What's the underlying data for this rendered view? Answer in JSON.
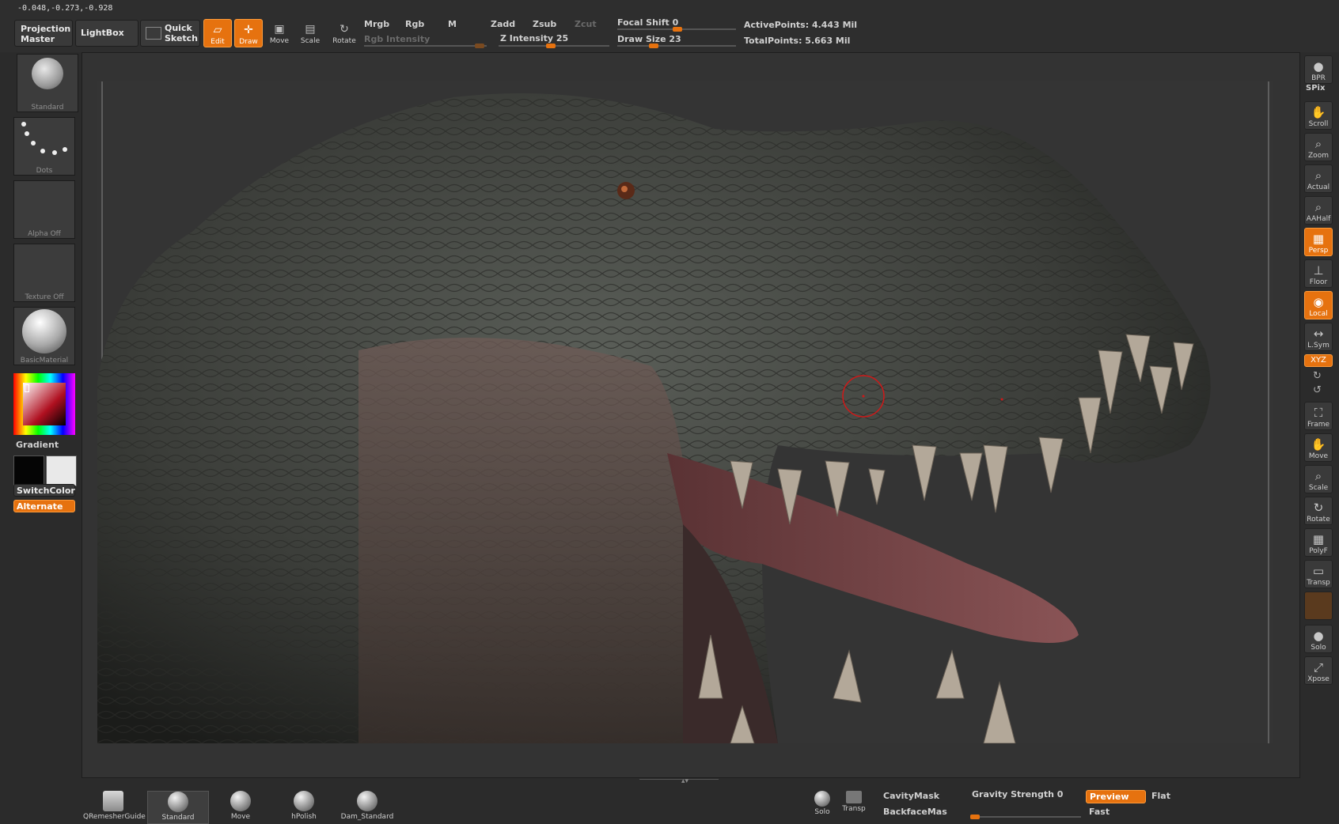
{
  "coords": "-0.048,-0.273,-0.928",
  "topbar": {
    "projection_master": "Projection Master",
    "lightbox": "LightBox",
    "quick_sketch": "Quick Sketch",
    "tools": [
      {
        "label": "Edit",
        "icon": "edit-icon",
        "active": true
      },
      {
        "label": "Draw",
        "icon": "draw-icon",
        "active": true
      },
      {
        "label": "Move",
        "icon": "move-icon",
        "active": false
      },
      {
        "label": "Scale",
        "icon": "scale-icon",
        "active": false
      },
      {
        "label": "Rotate",
        "icon": "rotate-icon",
        "active": false
      }
    ],
    "mrgb": "Mrgb",
    "rgb": "Rgb",
    "m": "M",
    "rgb_intensity": "Rgb Intensity",
    "zadd": "Zadd",
    "zsub": "Zsub",
    "zcut": "Zcut",
    "z_intensity": "Z Intensity 25",
    "focal_shift": "Focal Shift 0",
    "draw_size": "Draw Size 23",
    "active_points": "ActivePoints: 4.443 Mil",
    "total_points": "TotalPoints: 5.663 Mil"
  },
  "leftpanel": {
    "brush_label": "Standard",
    "stroke_label": "Dots",
    "alpha_label": "Alpha Off",
    "texture_label": "Texture Off",
    "material_label": "BasicMaterial",
    "gradient": "Gradient",
    "switch_color": "SwitchColor",
    "alternate": "Alternate"
  },
  "rightshelf": [
    {
      "label": "BPR",
      "icon": "bpr-icon",
      "active": false
    },
    {
      "label": "SPix",
      "icon": "spix-icon",
      "active": false
    },
    {
      "label": "Scroll",
      "icon": "scroll-icon",
      "active": false
    },
    {
      "label": "Zoom",
      "icon": "zoom-icon",
      "active": false
    },
    {
      "label": "Actual",
      "icon": "actual-icon",
      "active": false
    },
    {
      "label": "AAHalf",
      "icon": "aahalf-icon",
      "active": false
    },
    {
      "label": "Persp",
      "icon": "persp-icon",
      "active": true
    },
    {
      "label": "Floor",
      "icon": "floor-icon",
      "active": false
    },
    {
      "label": "Local",
      "icon": "local-icon",
      "active": true
    },
    {
      "label": "L.Sym",
      "icon": "lsym-icon",
      "active": false
    },
    {
      "label": "XYZ",
      "icon": "xyz-icon",
      "active": true
    },
    {
      "label": "Frame",
      "icon": "frame-icon",
      "active": false
    },
    {
      "label": "Move",
      "icon": "move-view-icon",
      "active": false
    },
    {
      "label": "Scale",
      "icon": "scale-view-icon",
      "active": false
    },
    {
      "label": "Rotate",
      "icon": "rotate-view-icon",
      "active": false
    },
    {
      "label": "PolyF",
      "icon": "polyf-icon",
      "active": false
    },
    {
      "label": "Transp",
      "icon": "transp-icon",
      "active": false
    },
    {
      "label": "Solo",
      "icon": "solo-icon",
      "active": false
    },
    {
      "label": "Xpose",
      "icon": "xpose-icon",
      "active": false
    }
  ],
  "bottom": {
    "brushes": [
      "QRemesherGuide",
      "Standard",
      "Move",
      "hPolish",
      "Dam_Standard"
    ],
    "solo": "Solo",
    "transp": "Transp",
    "cavity_mask": "CavityMask",
    "backface_mask": "BackfaceMas",
    "gravity_strength": "Gravity Strength 0",
    "preview": "Preview",
    "flat": "Flat",
    "fast": "Fast"
  },
  "colors": {
    "accent": "#e6720f",
    "panel": "#2b2b2b",
    "viewport": "#333333"
  }
}
